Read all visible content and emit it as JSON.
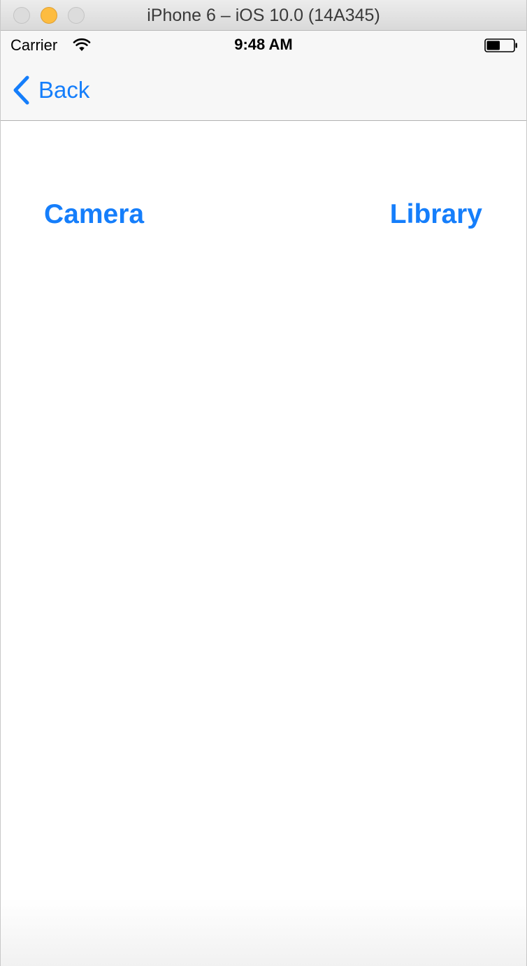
{
  "window": {
    "title": "iPhone 6 – iOS 10.0 (14A345)"
  },
  "status_bar": {
    "carrier": "Carrier",
    "time": "9:48 AM",
    "wifi_icon": "wifi-icon",
    "battery_icon": "battery-icon",
    "battery_level": 0.5
  },
  "nav_bar": {
    "back_label": "Back",
    "back_icon": "chevron-left-icon"
  },
  "main": {
    "camera_label": "Camera",
    "library_label": "Library"
  },
  "colors": {
    "accent": "#157efb",
    "bar_background": "#f7f7f7",
    "content_background": "#ffffff"
  }
}
